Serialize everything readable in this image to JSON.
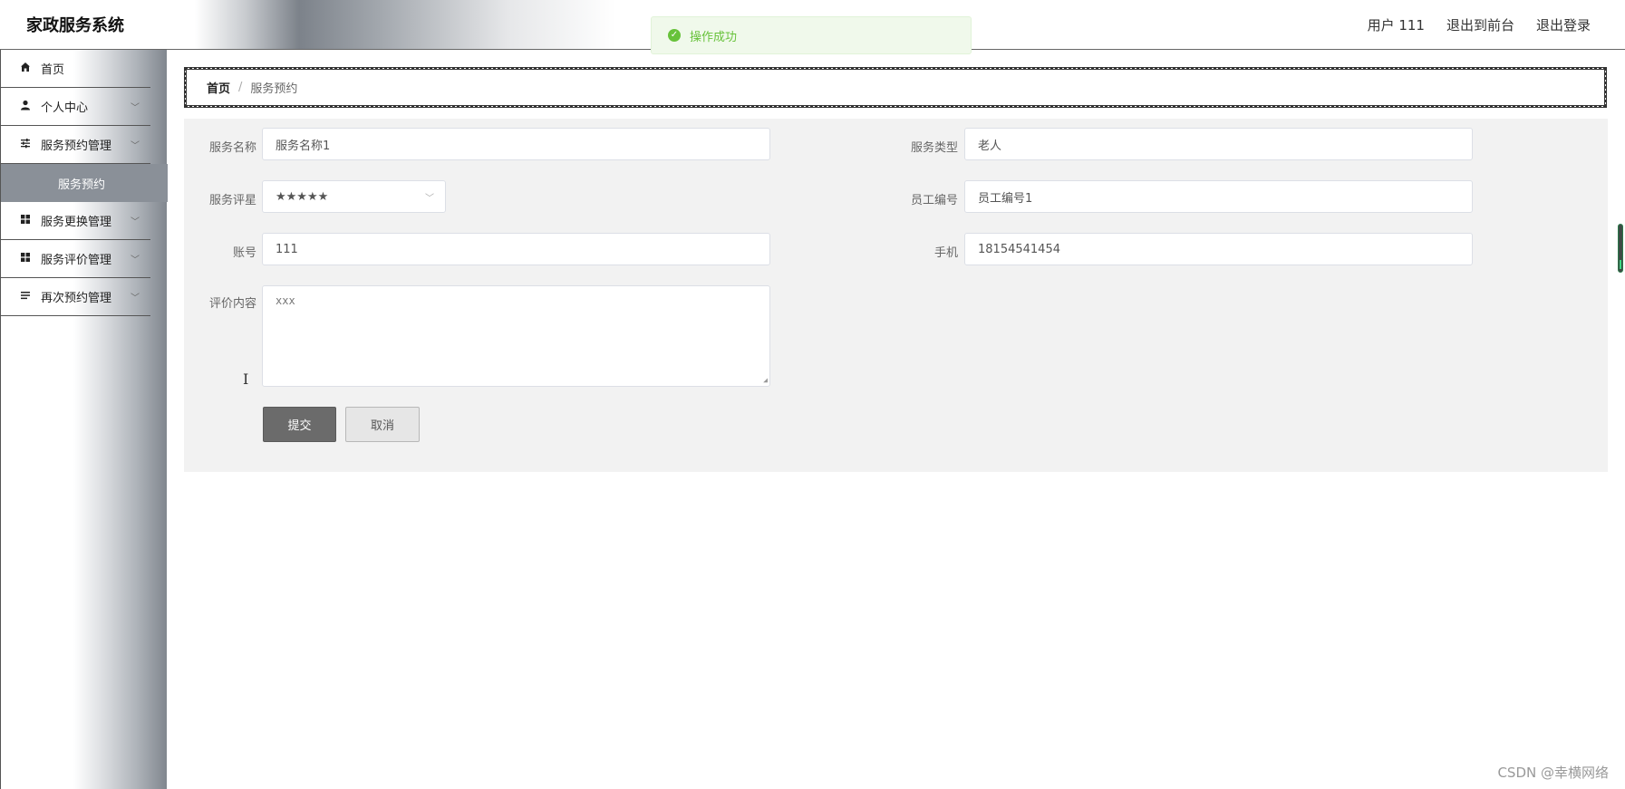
{
  "header": {
    "title": "家政服务系统",
    "user_label": "用户 111",
    "front_link": "退出到前台",
    "logout_link": "退出登录"
  },
  "toast": {
    "message": "操作成功",
    "type": "success"
  },
  "sidebar": {
    "items": [
      {
        "label": "首页",
        "icon": "home-icon",
        "expandable": false
      },
      {
        "label": "个人中心",
        "icon": "user-icon",
        "expandable": true
      },
      {
        "label": "服务预约管理",
        "icon": "sliders-icon",
        "expandable": true
      },
      {
        "label": "服务预约",
        "submenu": true,
        "active": true
      },
      {
        "label": "服务更换管理",
        "icon": "grid-icon",
        "expandable": true
      },
      {
        "label": "服务评价管理",
        "icon": "grid-icon",
        "expandable": true
      },
      {
        "label": "再次预约管理",
        "icon": "list-icon",
        "expandable": true
      }
    ]
  },
  "breadcrumb": {
    "home": "首页",
    "separator": "/",
    "current": "服务预约"
  },
  "form": {
    "service_name": {
      "label": "服务名称",
      "value": "服务名称1"
    },
    "service_type": {
      "label": "服务类型",
      "value": "老人"
    },
    "rating": {
      "label": "服务评星",
      "value": "★★★★★"
    },
    "staff_id": {
      "label": "员工编号",
      "value": "员工编号1"
    },
    "account": {
      "label": "账号",
      "value": "111"
    },
    "phone": {
      "label": "手机",
      "value": "18154541454"
    },
    "review": {
      "label": "评价内容",
      "value": "xxx"
    },
    "submit_label": "提交",
    "cancel_label": "取消"
  },
  "watermark": "CSDN @幸横网络",
  "colors": {
    "success": "#67c23a",
    "active_menu": "#8a9098",
    "submit_button": "#6b6b6b"
  }
}
